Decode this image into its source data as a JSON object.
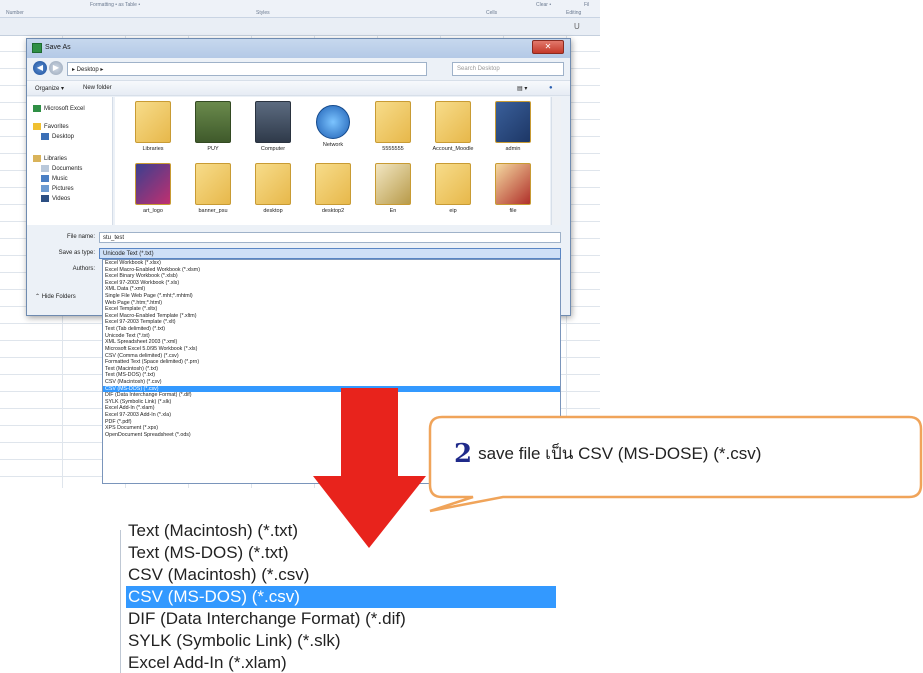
{
  "ribbon": {
    "top_labels": [
      "Formatting • as Table •",
      "Clear •",
      "Fil"
    ],
    "group_labels": [
      "Number",
      "Styles",
      "Cells",
      "Editing"
    ]
  },
  "sheet": {
    "column_label": "U"
  },
  "dialog": {
    "title": "Save As",
    "path": "▸ Desktop ▸",
    "search_placeholder": "Search Desktop",
    "toolbar": {
      "organize": "Organize ▾",
      "new_folder": "New folder"
    },
    "nav_items": [
      "Microsoft Excel",
      "Favorites",
      "Desktop",
      "Libraries",
      "Documents",
      "Music",
      "Pictures",
      "Videos"
    ],
    "files_row1": [
      "Libraries",
      "PUY",
      "Computer",
      "Network",
      "5555555",
      "Account_Moodle",
      "admin"
    ],
    "files_row2": [
      "art_logo",
      "banner_psu",
      "desktop",
      "desktop2",
      "En",
      "eip",
      "file"
    ],
    "file_name_label": "File name:",
    "file_name_value": "stu_test",
    "save_type_label": "Save as type:",
    "save_type_value": "Unicode Text (*.txt)",
    "authors_label": "Authors:",
    "hide_folders": "Hide Folders"
  },
  "dropdown_items": [
    "Excel Workbook (*.xlsx)",
    "Excel Macro-Enabled Workbook (*.xlsm)",
    "Excel Binary Workbook (*.xlsb)",
    "Excel 97-2003 Workbook (*.xls)",
    "XML Data (*.xml)",
    "Single File Web Page (*.mht;*.mhtml)",
    "Web Page (*.htm;*.html)",
    "Excel Template (*.xltx)",
    "Excel Macro-Enabled Template (*.xltm)",
    "Excel 97-2003 Template (*.xlt)",
    "Text (Tab delimited) (*.txt)",
    "Unicode Text (*.txt)",
    "XML Spreadsheet 2003 (*.xml)",
    "Microsoft Excel 5.0/95 Workbook (*.xls)",
    "CSV (Comma delimited) (*.csv)",
    "Formatted Text (Space delimited) (*.prn)",
    "Text (Macintosh) (*.txt)",
    "Text (MS-DOS) (*.txt)",
    "CSV (Macintosh) (*.csv)",
    "CSV (MS-DOS) (*.csv)",
    "DIF (Data Interchange Format) (*.dif)",
    "SYLK (Symbolic Link) (*.slk)",
    "Excel Add-In (*.xlam)",
    "Excel 97-2003 Add-In (*.xla)",
    "PDF (*.pdf)",
    "XPS Document (*.xps)",
    "OpenDocument Spreadsheet (*.ods)"
  ],
  "dropdown_highlighted": "CSV (MS-DOS) (*.csv)",
  "zoom_items": [
    "Text (Macintosh) (*.txt)",
    "Text (MS-DOS) (*.txt)",
    "CSV (Macintosh) (*.csv)",
    "CSV (MS-DOS) (*.csv)",
    "DIF (Data Interchange Format) (*.dif)",
    "SYLK (Symbolic Link) (*.slk)",
    "Excel Add-In (*.xlam)"
  ],
  "callout": {
    "step_number": "2",
    "text": "save file เป็น CSV (MS-DOSE) (*.csv)"
  },
  "colors": {
    "highlight": "#3399ff",
    "arrow": "#e8231c",
    "callout_border": "#f0a45a",
    "step_number": "#1f2a8a"
  }
}
